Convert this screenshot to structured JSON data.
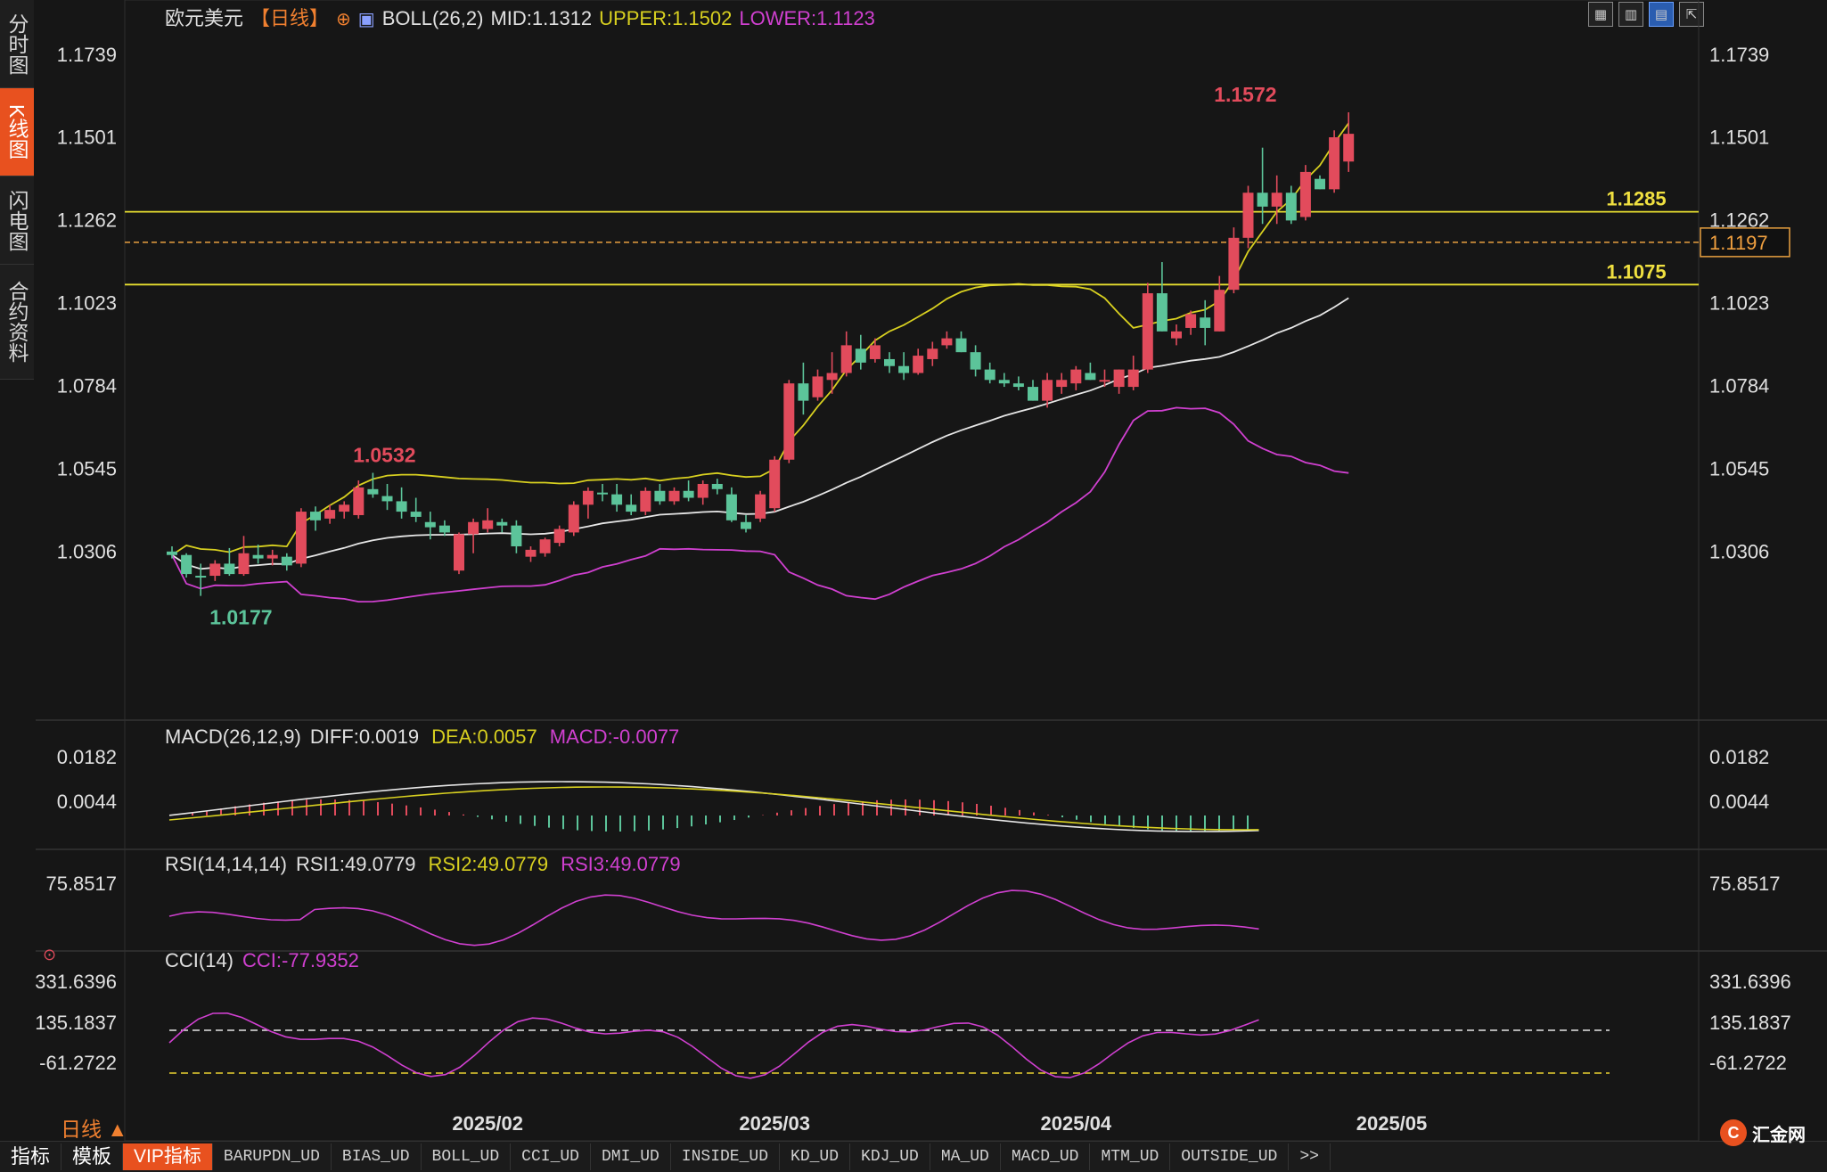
{
  "sidebar": {
    "tabs": [
      {
        "label": "分时图"
      },
      {
        "label": "K线图"
      },
      {
        "label": "闪电图"
      },
      {
        "label": "合约资料"
      }
    ],
    "active": 1
  },
  "header": {
    "symbol": "欧元美元",
    "period_tag": "【日线】",
    "boll_label": "BOLL(26,2)",
    "mid_text": "MID:1.1312",
    "upper_text": "UPPER:1.1502",
    "lower_text": "LOWER:1.1123"
  },
  "toolbar": {
    "icons": [
      "grid-icon",
      "bars-icon",
      "candle-icon",
      "export-icon"
    ]
  },
  "colors": {
    "background": "#161616",
    "up": "#e24b5c",
    "down": "#5cc49a",
    "mid": "#e6e6e6",
    "upper": "#d8d020",
    "lower": "#d040d0",
    "level_line": "#e8e030",
    "dashed": "#e8a040"
  },
  "chart_data": [
    {
      "type": "candlestick",
      "title": "欧元美元【日线】",
      "y_ticks": [
        "1.1739",
        "1.1501",
        "1.1262",
        "1.1023",
        "1.0784",
        "1.0545",
        "1.0306"
      ],
      "ylim": [
        1.0104,
        1.1788
      ],
      "x_ticks": [
        {
          "label": "2025/02",
          "bar": 22
        },
        {
          "label": "2025/03",
          "bar": 42
        },
        {
          "label": "2025/04",
          "bar": 63
        },
        {
          "label": "2025/05",
          "bar": 85
        }
      ],
      "levels": [
        {
          "value": 1.1285,
          "label": "1.1285"
        },
        {
          "value": 1.1075,
          "label": "1.1075"
        }
      ],
      "current": {
        "value": 1.1197,
        "label": "1.1197"
      },
      "extremes": [
        {
          "label": "1.1572",
          "bar": 72,
          "value": 1.1572,
          "kind": "high"
        },
        {
          "label": "1.0532",
          "bar": 12,
          "value": 1.0532,
          "kind": "high"
        },
        {
          "label": "1.0177",
          "bar": 2,
          "value": 1.0177,
          "kind": "low"
        }
      ],
      "ohlc": [
        [
          1.0305,
          1.032,
          1.0285,
          1.0295
        ],
        [
          1.0295,
          1.03,
          1.023,
          1.024
        ],
        [
          1.0235,
          1.027,
          1.0177,
          1.023
        ],
        [
          1.0235,
          1.028,
          1.022,
          1.027
        ],
        [
          1.027,
          1.0315,
          1.0235,
          1.024
        ],
        [
          1.024,
          1.035,
          1.0235,
          1.03
        ],
        [
          1.0295,
          1.0325,
          1.027,
          1.0285
        ],
        [
          1.0285,
          1.031,
          1.0265,
          1.0295
        ],
        [
          1.029,
          1.03,
          1.025,
          1.0265
        ],
        [
          1.027,
          1.043,
          1.026,
          1.042
        ],
        [
          1.042,
          1.0435,
          1.0365,
          1.0395
        ],
        [
          1.04,
          1.044,
          1.0385,
          1.0425
        ],
        [
          1.042,
          1.045,
          1.04,
          1.044
        ],
        [
          1.041,
          1.051,
          1.04,
          1.049
        ],
        [
          1.0485,
          1.0532,
          1.046,
          1.047
        ],
        [
          1.0465,
          1.05,
          1.0425,
          1.045
        ],
        [
          1.045,
          1.049,
          1.04,
          1.042
        ],
        [
          1.042,
          1.046,
          1.039,
          1.0405
        ],
        [
          1.039,
          1.042,
          1.034,
          1.0375
        ],
        [
          1.038,
          1.0395,
          1.035,
          1.036
        ],
        [
          1.025,
          1.036,
          1.024,
          1.0355
        ],
        [
          1.0355,
          1.04,
          1.03,
          1.039
        ],
        [
          1.037,
          1.043,
          1.036,
          1.0395
        ],
        [
          1.039,
          1.04,
          1.036,
          1.038
        ],
        [
          1.038,
          1.0395,
          1.03,
          1.032
        ],
        [
          1.029,
          1.032,
          1.0275,
          1.031
        ],
        [
          1.03,
          1.0345,
          1.029,
          1.034
        ],
        [
          1.033,
          1.038,
          1.032,
          1.037
        ],
        [
          1.036,
          1.045,
          1.035,
          1.044
        ],
        [
          1.044,
          1.049,
          1.04,
          1.048
        ],
        [
          1.0475,
          1.05,
          1.045,
          1.047
        ],
        [
          1.047,
          1.05,
          1.042,
          1.044
        ],
        [
          1.044,
          1.047,
          1.041,
          1.042
        ],
        [
          1.042,
          1.049,
          1.041,
          1.048
        ],
        [
          1.048,
          1.05,
          1.044,
          1.045
        ],
        [
          1.045,
          1.049,
          1.044,
          1.048
        ],
        [
          1.048,
          1.051,
          1.045,
          1.046
        ],
        [
          1.046,
          1.051,
          1.044,
          1.05
        ],
        [
          1.05,
          1.0515,
          1.047,
          1.0485
        ],
        [
          1.047,
          1.049,
          1.039,
          1.0395
        ],
        [
          1.039,
          1.041,
          1.036,
          1.037
        ],
        [
          1.04,
          1.048,
          1.039,
          1.047
        ],
        [
          1.043,
          1.058,
          1.042,
          1.057
        ],
        [
          1.057,
          1.08,
          1.056,
          1.079
        ],
        [
          1.079,
          1.085,
          1.07,
          1.074
        ],
        [
          1.075,
          1.083,
          1.074,
          1.081
        ],
        [
          1.08,
          1.088,
          1.076,
          1.082
        ],
        [
          1.082,
          1.094,
          1.081,
          1.09
        ],
        [
          1.089,
          1.093,
          1.083,
          1.085
        ],
        [
          1.086,
          1.092,
          1.085,
          1.09
        ],
        [
          1.086,
          1.088,
          1.082,
          1.084
        ],
        [
          1.084,
          1.088,
          1.08,
          1.082
        ],
        [
          1.082,
          1.089,
          1.0815,
          1.087
        ],
        [
          1.086,
          1.091,
          1.084,
          1.089
        ],
        [
          1.09,
          1.094,
          1.089,
          1.092
        ],
        [
          1.092,
          1.094,
          1.088,
          1.088
        ],
        [
          1.088,
          1.09,
          1.081,
          1.083
        ],
        [
          1.083,
          1.085,
          1.079,
          1.08
        ],
        [
          1.08,
          1.082,
          1.078,
          1.079
        ],
        [
          1.079,
          1.081,
          1.077,
          1.078
        ],
        [
          1.078,
          1.08,
          1.074,
          1.074
        ],
        [
          1.074,
          1.082,
          1.072,
          1.08
        ],
        [
          1.078,
          1.082,
          1.076,
          1.08
        ],
        [
          1.079,
          1.084,
          1.077,
          1.083
        ],
        [
          1.082,
          1.085,
          1.08,
          1.08
        ],
        [
          1.08,
          1.083,
          1.078,
          1.08
        ],
        [
          1.078,
          1.083,
          1.076,
          1.083
        ],
        [
          1.078,
          1.087,
          1.077,
          1.083
        ],
        [
          1.083,
          1.108,
          1.082,
          1.105
        ],
        [
          1.105,
          1.114,
          1.094,
          1.094
        ],
        [
          1.092,
          1.096,
          1.09,
          1.094
        ],
        [
          1.095,
          1.1,
          1.093,
          1.099
        ],
        [
          1.098,
          1.103,
          1.09,
          1.095
        ],
        [
          1.094,
          1.11,
          1.094,
          1.106
        ],
        [
          1.106,
          1.124,
          1.105,
          1.121
        ],
        [
          1.121,
          1.136,
          1.118,
          1.134
        ],
        [
          1.134,
          1.147,
          1.125,
          1.13
        ],
        [
          1.13,
          1.139,
          1.125,
          1.134
        ],
        [
          1.134,
          1.136,
          1.125,
          1.126
        ],
        [
          1.127,
          1.142,
          1.126,
          1.14
        ],
        [
          1.138,
          1.139,
          1.135,
          1.135
        ],
        [
          1.135,
          1.152,
          1.134,
          1.15
        ],
        [
          1.143,
          1.1572,
          1.14,
          1.151
        ]
      ],
      "series": [
        {
          "name": "MID",
          "values": []
        },
        {
          "name": "UPPER",
          "values": []
        },
        {
          "name": "LOWER",
          "values": []
        }
      ]
    },
    {
      "type": "line",
      "title": "MACD(26,12,9)",
      "labels": [
        "DIFF:0.0019",
        "DEA:0.0057",
        "MACD:-0.0077"
      ],
      "y_ticks": [
        "0.0182",
        "0.0044"
      ]
    },
    {
      "type": "line",
      "title": "RSI(14,14,14)",
      "labels": [
        "RSI1:49.0779",
        "RSI2:49.0779",
        "RSI3:49.0779"
      ],
      "y_ticks": [
        "75.8517"
      ]
    },
    {
      "type": "line",
      "title": "CCI(14)",
      "labels": [
        "CCI:-77.9352"
      ],
      "y_ticks": [
        "331.6396",
        "135.1837",
        "-61.2722"
      ]
    }
  ],
  "period_label": "日线 ▲",
  "bottom_tabs": [
    "指标",
    "模板",
    "VIP指标",
    "BARUPDN_UD",
    "BIAS_UD",
    "BOLL_UD",
    "CCI_UD",
    "DMI_UD",
    "INSIDE_UD",
    "KD_UD",
    "KDJ_UD",
    "MA_UD",
    "MACD_UD",
    "MTM_UD",
    "OUTSIDE_UD",
    ">>"
  ],
  "logo_text": "汇金网"
}
